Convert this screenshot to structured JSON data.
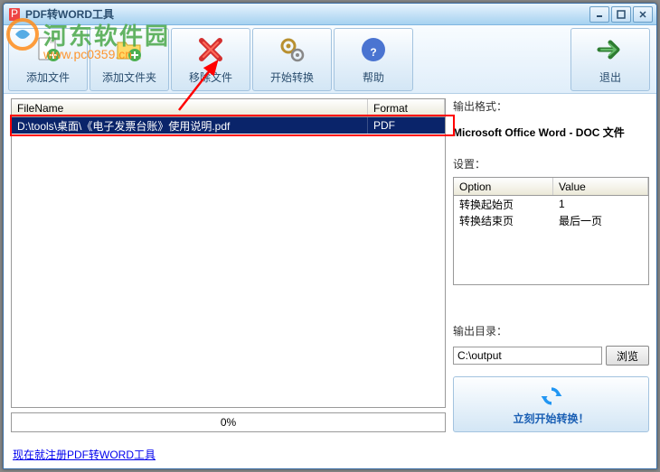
{
  "window": {
    "title": "PDF转WORD工具"
  },
  "toolbar": {
    "add_file": "添加文件",
    "add_folder": "添加文件夹",
    "remove_file": "移除文件",
    "start_convert": "开始转换",
    "help": "帮助",
    "exit": "退出"
  },
  "table": {
    "header_filename": "FileName",
    "header_format": "Format",
    "rows": [
      {
        "filename": "D:\\tools\\桌面\\《电子发票台账》使用说明.pdf",
        "format": "PDF"
      }
    ]
  },
  "progress": {
    "text": "0%"
  },
  "right": {
    "output_format_label": "输出格式：",
    "output_format_value": "Microsoft Office Word - DOC 文件",
    "settings_label": "设置：",
    "settings": {
      "header_option": "Option",
      "header_value": "Value",
      "rows": [
        {
          "option": "转换起始页",
          "value": "1"
        },
        {
          "option": "转换结束页",
          "value": "最后一页"
        }
      ]
    },
    "output_dir_label": "输出目录：",
    "output_dir_value": "C:\\output",
    "browse": "浏览",
    "convert_now": "立刻开始转换！"
  },
  "footer": {
    "register_link": "现在就注册PDF转WORD工具"
  },
  "watermark": {
    "site_name": "河东软件园",
    "url": "www.pc0359.cn"
  }
}
